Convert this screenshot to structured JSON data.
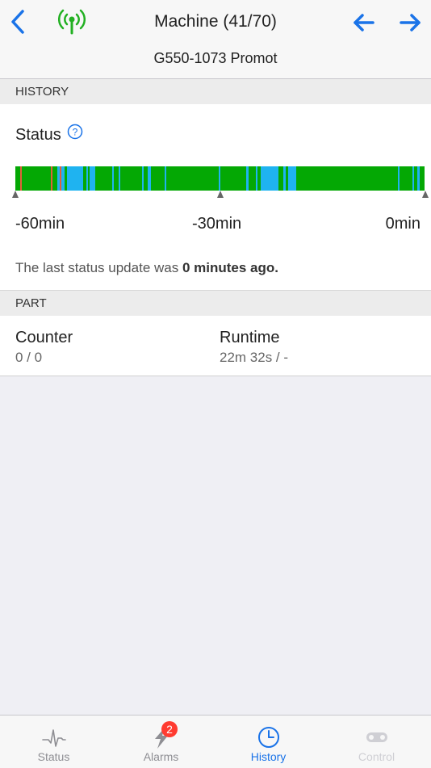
{
  "header": {
    "title": "Machine (41/70)",
    "subtitle": "G550-1073 Promot",
    "back_icon": "chevron-left-icon",
    "signal_icon": "antenna-signal-icon",
    "prev_icon": "arrow-left-icon",
    "next_icon": "arrow-right-icon",
    "accent_color": "#1a73e8",
    "signal_color": "#22b022"
  },
  "history": {
    "section_label": "HISTORY",
    "status_label": "Status",
    "help_icon": "question-circle-icon",
    "timeline_labels": [
      "-60min",
      "-30min",
      "0min"
    ],
    "update_prefix": "The last status update was ",
    "update_emphasis": "0 minutes ago.",
    "status_colors": {
      "running": "#04a804",
      "idle": "#1fb3f0",
      "alarm": "#e0603a"
    }
  },
  "part": {
    "section_label": "PART",
    "counter_label": "Counter",
    "counter_value": "0 / 0",
    "runtime_label": "Runtime",
    "runtime_value": "22m 32s / -"
  },
  "tabbar": {
    "tabs": [
      {
        "label": "Status",
        "icon": "pulse-icon",
        "state": "normal"
      },
      {
        "label": "Alarms",
        "icon": "lightning-icon",
        "state": "normal",
        "badge": "2"
      },
      {
        "label": "History",
        "icon": "clock-icon",
        "state": "active"
      },
      {
        "label": "Control",
        "icon": "toggle-icon",
        "state": "disabled"
      }
    ]
  }
}
